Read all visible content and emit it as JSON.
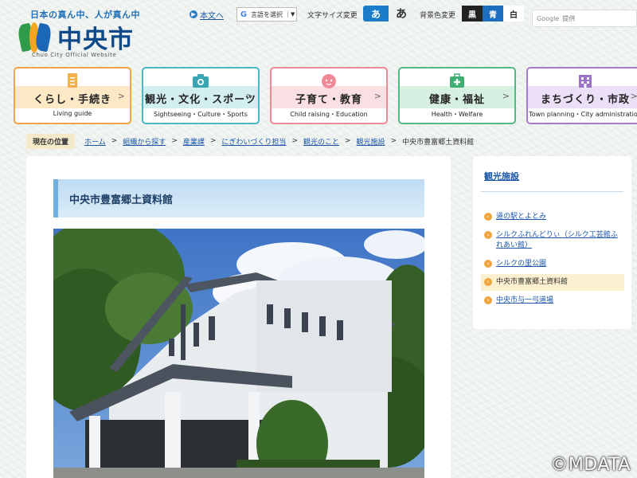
{
  "header": {
    "tagline": "日本の真ん中、人が真ん中",
    "logo_text": "中央市",
    "logo_sub": "Chuo City Official Website",
    "skip_link": "本文へ",
    "translate_label": "言語を選択",
    "translate_caret": "▼",
    "font_size_label": "文字サイズ変更",
    "font_small": "あ",
    "font_large": "あ",
    "bg_label": "背景色変更",
    "bg_black": "黒",
    "bg_blue": "青",
    "bg_white": "白",
    "search_brand": "Google",
    "search_suffix": "提供"
  },
  "nav": [
    {
      "title": "くらし・手続き",
      "sub": "Living guide",
      "color": "#f0a640",
      "icon": "document-icon"
    },
    {
      "title": "観光・文化・スポーツ",
      "sub": "Sightseeing・Culture・Sports",
      "color": "#4cb7c2",
      "icon": "camera-icon"
    },
    {
      "title": "子育て・教育",
      "sub": "Child raising・Education",
      "color": "#ec8a95",
      "icon": "child-face-icon"
    },
    {
      "title": "健康・福祉",
      "sub": "Health・Welfare",
      "color": "#4fbb82",
      "icon": "medical-bag-icon"
    },
    {
      "title": "まちづくり・市政",
      "sub": "Town planning・City administration",
      "color": "#a37bcf",
      "icon": "building-icon"
    }
  ],
  "breadcrumb": {
    "label": "現在の位置",
    "links": [
      "ホーム",
      "組織から探す",
      "産業課",
      "にぎわいづくり担当",
      "観光のこと",
      "観光施設"
    ],
    "current": "中央市豊富郷土資料館"
  },
  "main": {
    "title": "中央市豊富郷土資料館",
    "photo_alt": "中央市豊富郷土資料館の外観写真"
  },
  "sidebar": {
    "heading": "観光施設",
    "items": [
      {
        "label": "道の駅とよとみ",
        "active": false
      },
      {
        "label": "シルクふれんどりぃ（シルク工芸館ふれあい館）",
        "active": false
      },
      {
        "label": "シルクの里公園",
        "active": false
      },
      {
        "label": "中央市豊富郷土資料館",
        "active": true
      },
      {
        "label": "中央市与一弓道場",
        "active": false
      }
    ]
  },
  "watermark": "©MDATA",
  "colors": {
    "accent_blue": "#1b7cc9",
    "link": "#1a55a8",
    "title_bar": "#bfdcf3"
  }
}
